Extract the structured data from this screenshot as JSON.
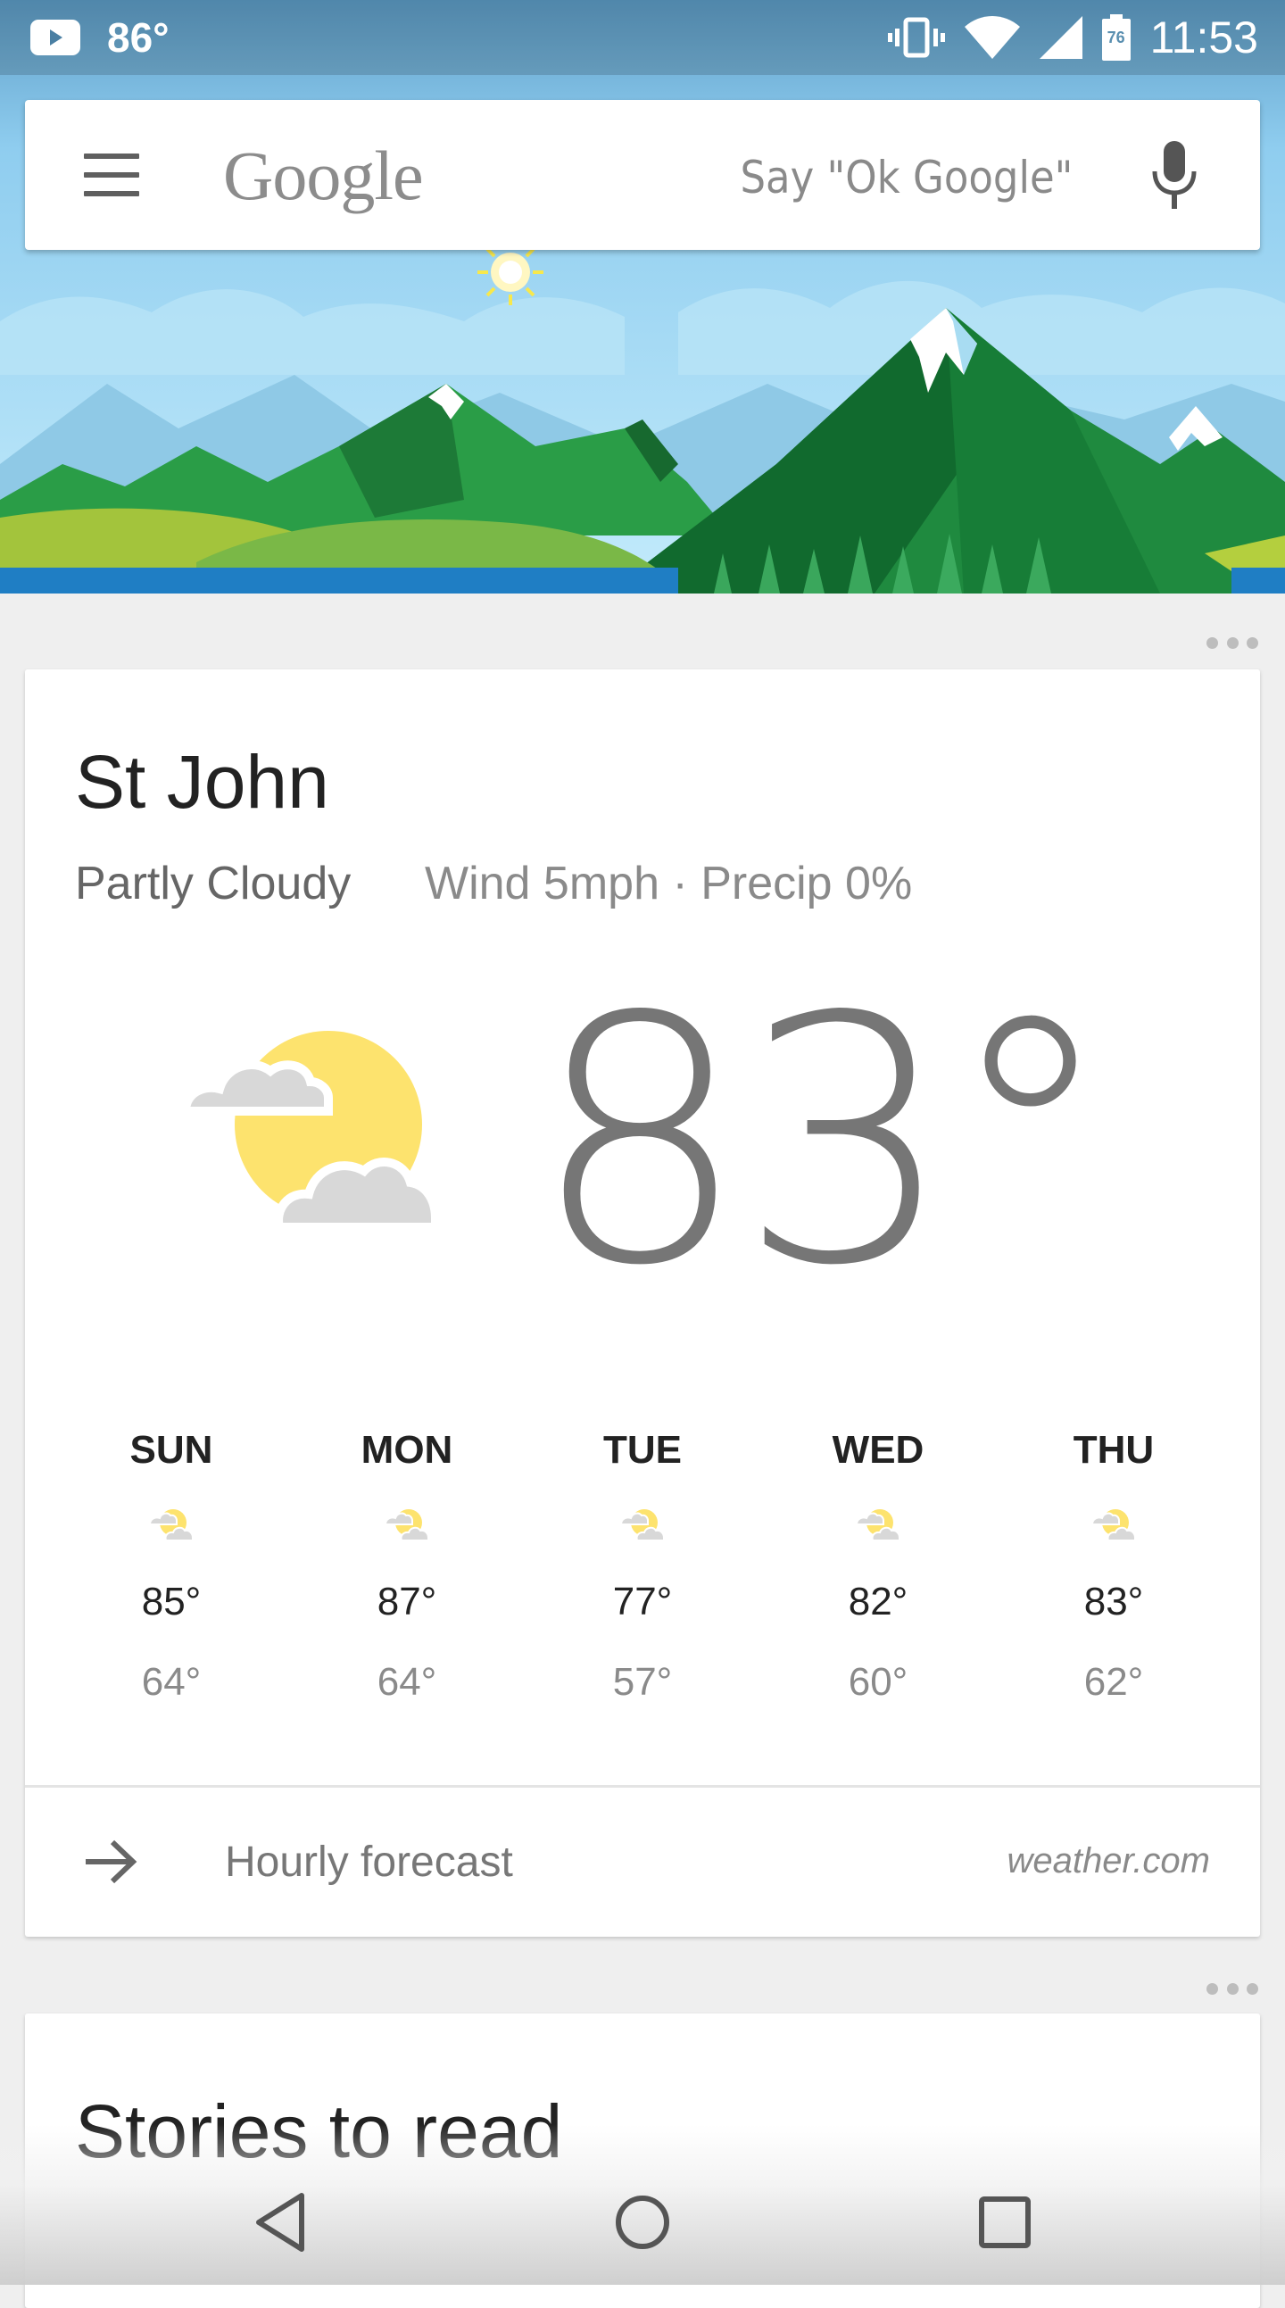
{
  "status_bar": {
    "temperature": "86°",
    "battery_level": "76",
    "time": "11:53",
    "icons": [
      "youtube-icon",
      "vibrate-icon",
      "wifi-icon",
      "signal-icon",
      "battery-icon"
    ]
  },
  "search": {
    "logo_text": "Google",
    "hint": "Say \"Ok Google\"",
    "icons": [
      "menu-icon",
      "mic-icon"
    ]
  },
  "weather": {
    "city": "St John",
    "condition": "Partly Cloudy",
    "details": "Wind 5mph · Precip 0%",
    "current_temp": "83°",
    "icon": "partly-cloudy-icon",
    "forecast": [
      {
        "day": "SUN",
        "high": "85°",
        "low": "64°"
      },
      {
        "day": "MON",
        "high": "87°",
        "low": "64°"
      },
      {
        "day": "TUE",
        "high": "77°",
        "low": "57°"
      },
      {
        "day": "WED",
        "high": "82°",
        "low": "60°"
      },
      {
        "day": "THU",
        "high": "83°",
        "low": "62°"
      }
    ],
    "hourly_label": "Hourly forecast",
    "source": "weather.com"
  },
  "stories": {
    "title": "Stories to read"
  },
  "nav": {
    "icons": [
      "back-icon",
      "home-icon",
      "recents-icon"
    ]
  },
  "colors": {
    "sky": "#aee0f7",
    "mountain_green": "#1e8a3e",
    "sun": "#fde36e",
    "cloud": "#d6d6d6",
    "text_primary": "#222222",
    "text_secondary": "#8a8a8a"
  }
}
